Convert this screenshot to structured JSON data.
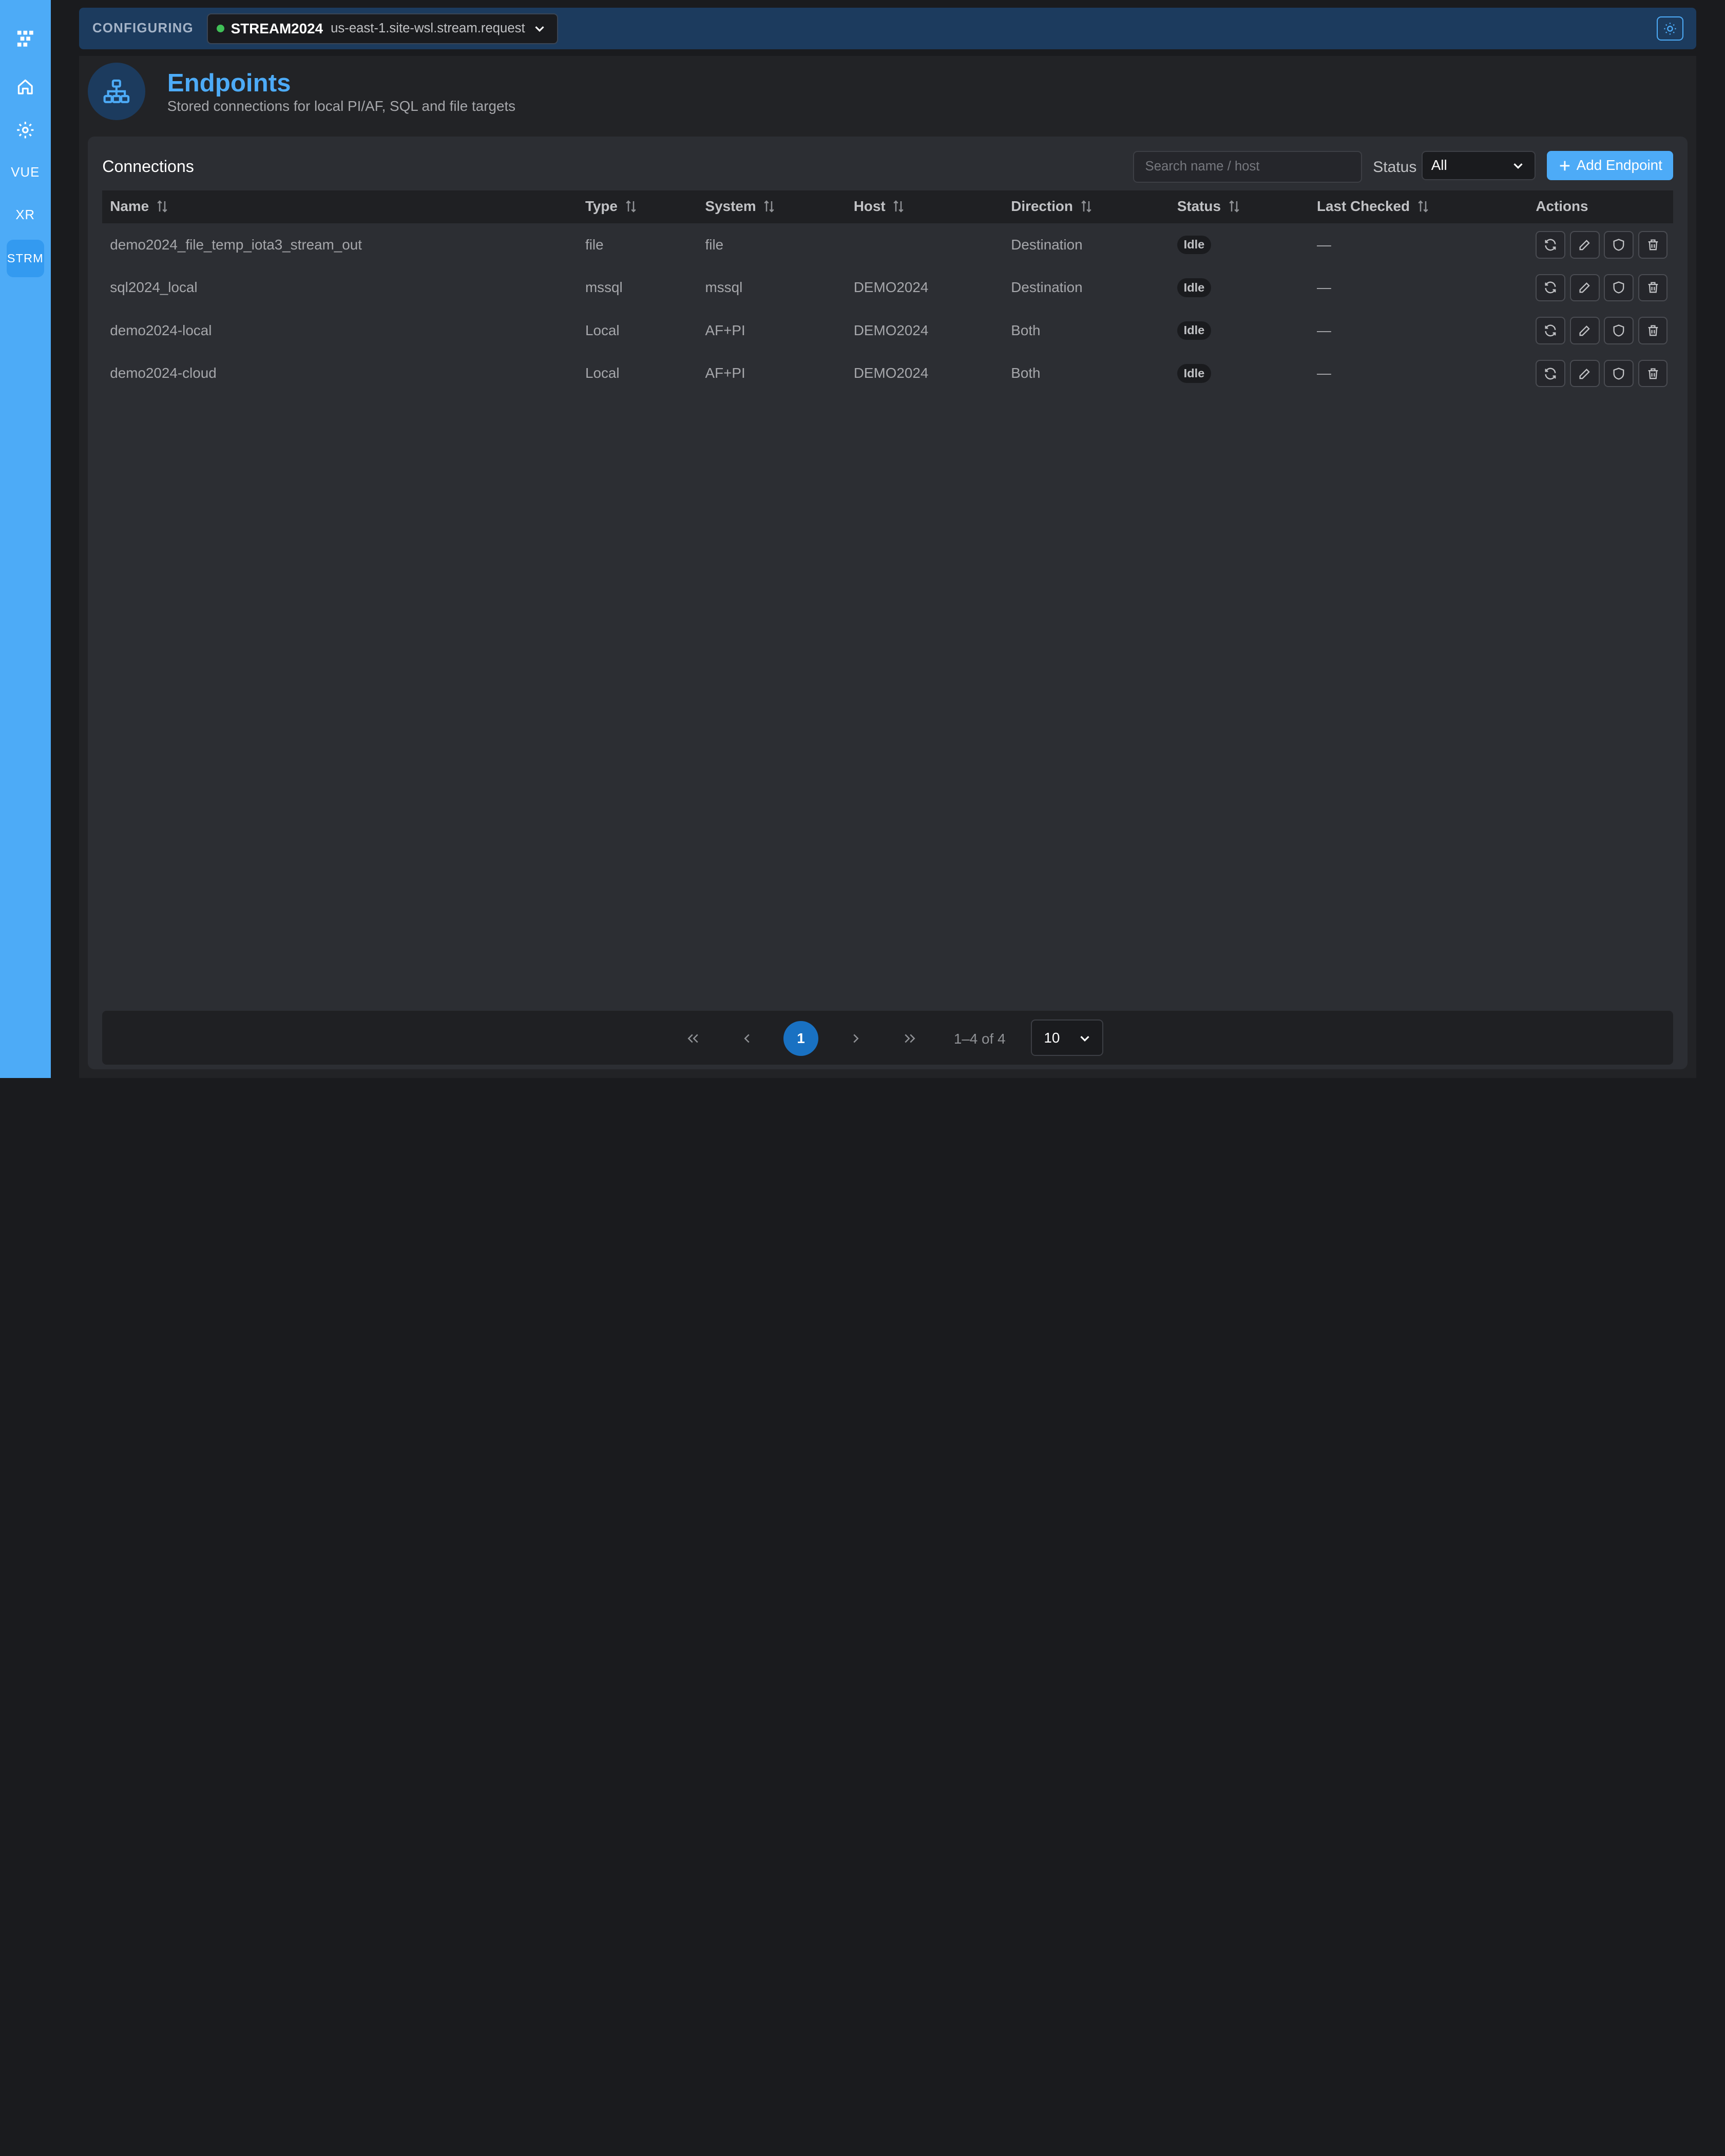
{
  "rail": {
    "items": [
      {
        "name": "logo",
        "icon": "logo-icon"
      },
      {
        "name": "home",
        "icon": "home-icon"
      },
      {
        "name": "settings",
        "icon": "gear-icon"
      },
      {
        "name": "vue",
        "label": "VUE"
      },
      {
        "name": "xr",
        "label": "XR"
      },
      {
        "name": "strm",
        "label": "STRM",
        "active": true
      }
    ]
  },
  "topbar": {
    "configuring_label": "CONFIGURING",
    "environment": {
      "name": "STREAM2024",
      "host": "us-east-1.site-wsl.stream.request",
      "status_color": "#40c057"
    },
    "theme_toggle_icon": "sun-icon"
  },
  "header": {
    "title": "Endpoints",
    "subtitle": "Stored connections for local PI/AF, SQL and file targets",
    "icon": "network-hierarchy-icon"
  },
  "connections": {
    "title": "Connections",
    "search_placeholder": "Search name / host",
    "status_filter_label": "Status",
    "status_filter_value": "All",
    "add_button_label": "Add Endpoint",
    "columns": [
      "Name",
      "Type",
      "System",
      "Host",
      "Direction",
      "Status",
      "Last Checked",
      "Actions"
    ],
    "rows": [
      {
        "name": "demo2024_file_temp_iota3_stream_out",
        "type": "file",
        "system": "file",
        "host": "",
        "direction": "Destination",
        "status": "Idle",
        "last_checked": "—"
      },
      {
        "name": "sql2024_local",
        "type": "mssql",
        "system": "mssql",
        "host": "DEMO2024",
        "direction": "Destination",
        "status": "Idle",
        "last_checked": "—"
      },
      {
        "name": "demo2024-local",
        "type": "Local",
        "system": "AF+PI",
        "host": "DEMO2024",
        "direction": "Both",
        "status": "Idle",
        "last_checked": "—"
      },
      {
        "name": "demo2024-cloud",
        "type": "Local",
        "system": "AF+PI",
        "host": "DEMO2024",
        "direction": "Both",
        "status": "Idle",
        "last_checked": "—"
      }
    ],
    "row_actions": [
      "refresh-icon",
      "edit-pencil-icon",
      "shield-icon",
      "trash-icon"
    ]
  },
  "pagination": {
    "current_page": "1",
    "range_text": "1–4 of 4",
    "per_page": "10"
  },
  "colors": {
    "accent": "#4dabf7",
    "topbar_bg": "#1c3b5e",
    "page_bg": "#1a1b1e",
    "card_bg": "#2c2e33",
    "current_page_bg": "#1971c2"
  }
}
